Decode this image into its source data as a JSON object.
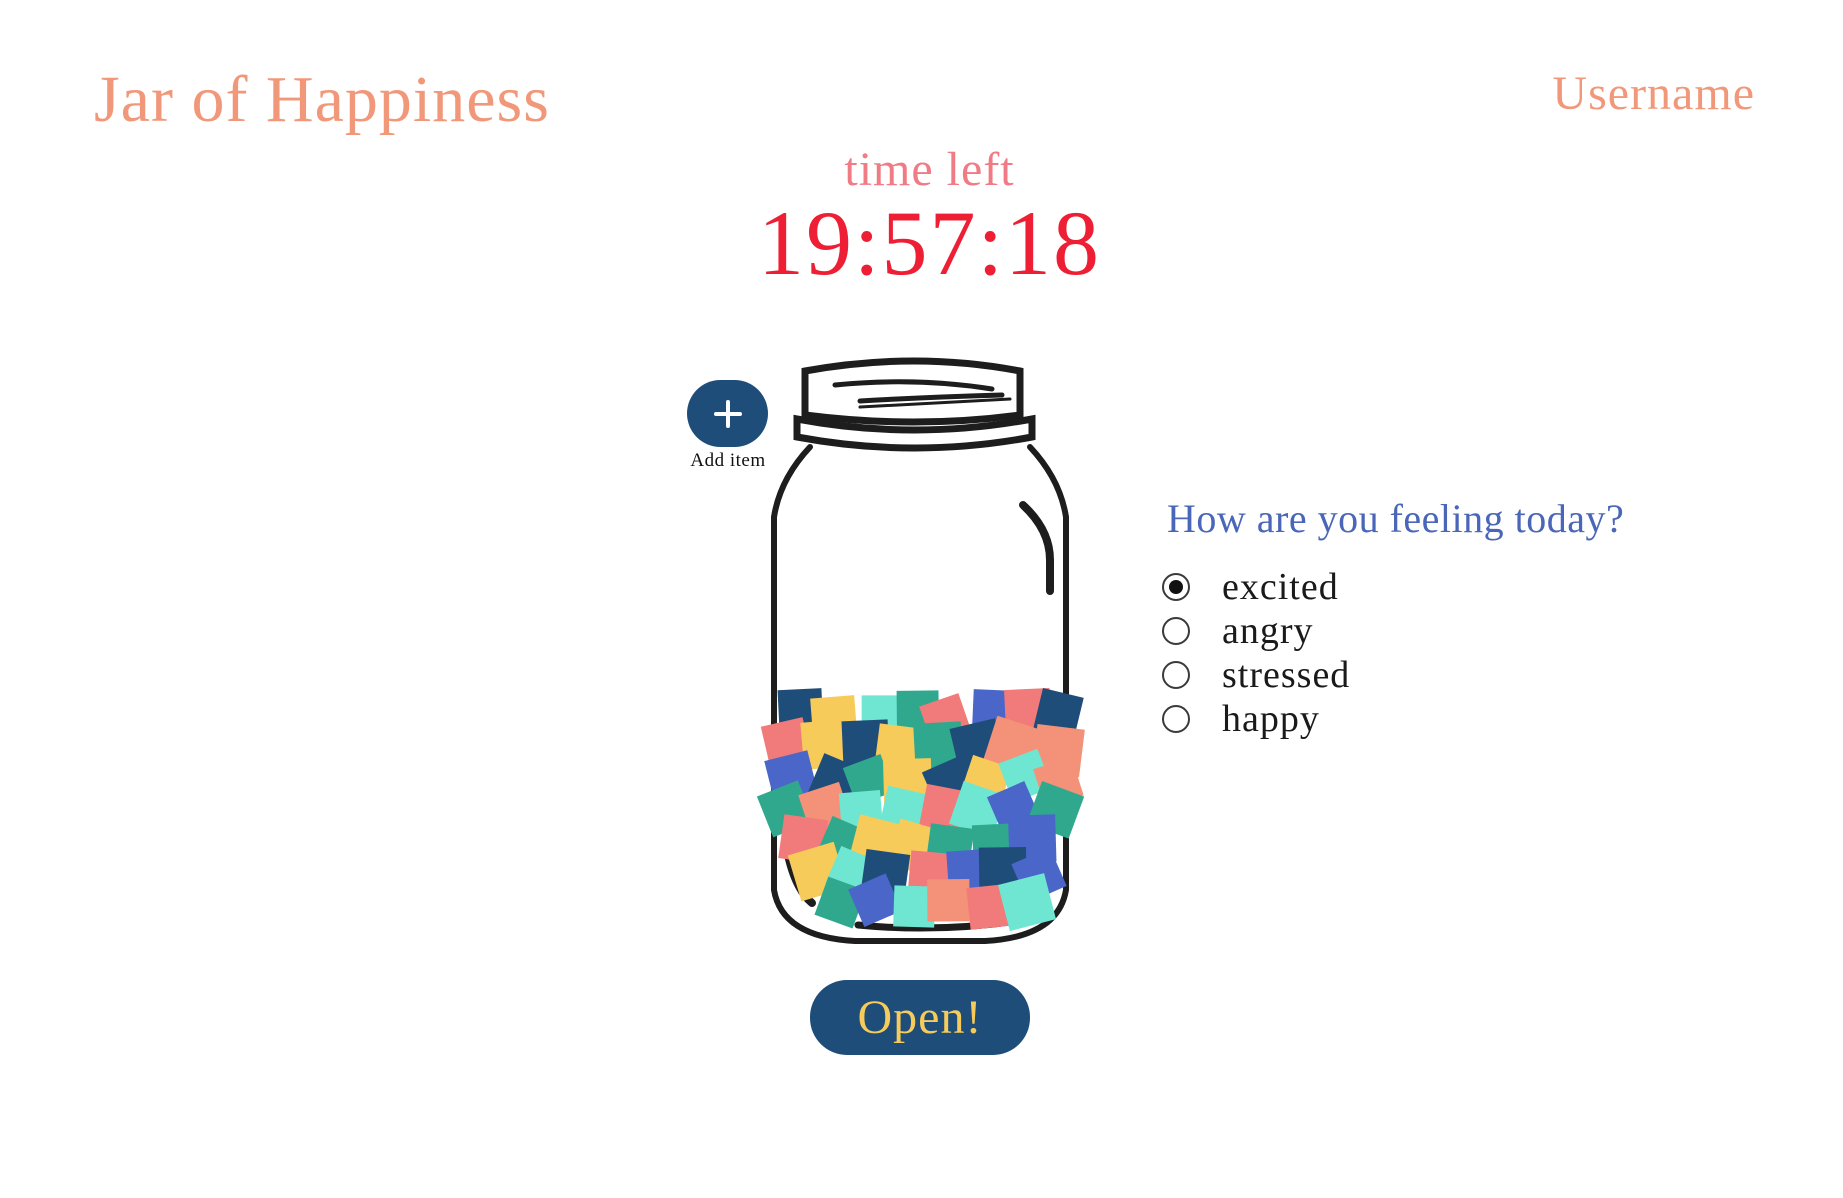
{
  "app": {
    "title": "Jar of Happiness",
    "username": "Username"
  },
  "timer": {
    "label": "time left",
    "value": "19:57:18"
  },
  "jar": {
    "add_label": "Add item",
    "open_label": "Open!",
    "note_colors": [
      "#6ee6d2",
      "#1f4d79",
      "#4a66c8",
      "#2fa88e",
      "#f6cb5a",
      "#f39278",
      "#f17a7a"
    ]
  },
  "mood": {
    "question": "How are you feeling today?",
    "selected": "excited",
    "options": [
      "excited",
      "angry",
      "stressed",
      "happy"
    ]
  },
  "colors": {
    "title": "#f2987a",
    "timer": "#ee1f34",
    "timer_label": "#f07b84",
    "question": "#4a66b8",
    "button": "#1f4d79",
    "open_text": "#f6cb5a"
  }
}
